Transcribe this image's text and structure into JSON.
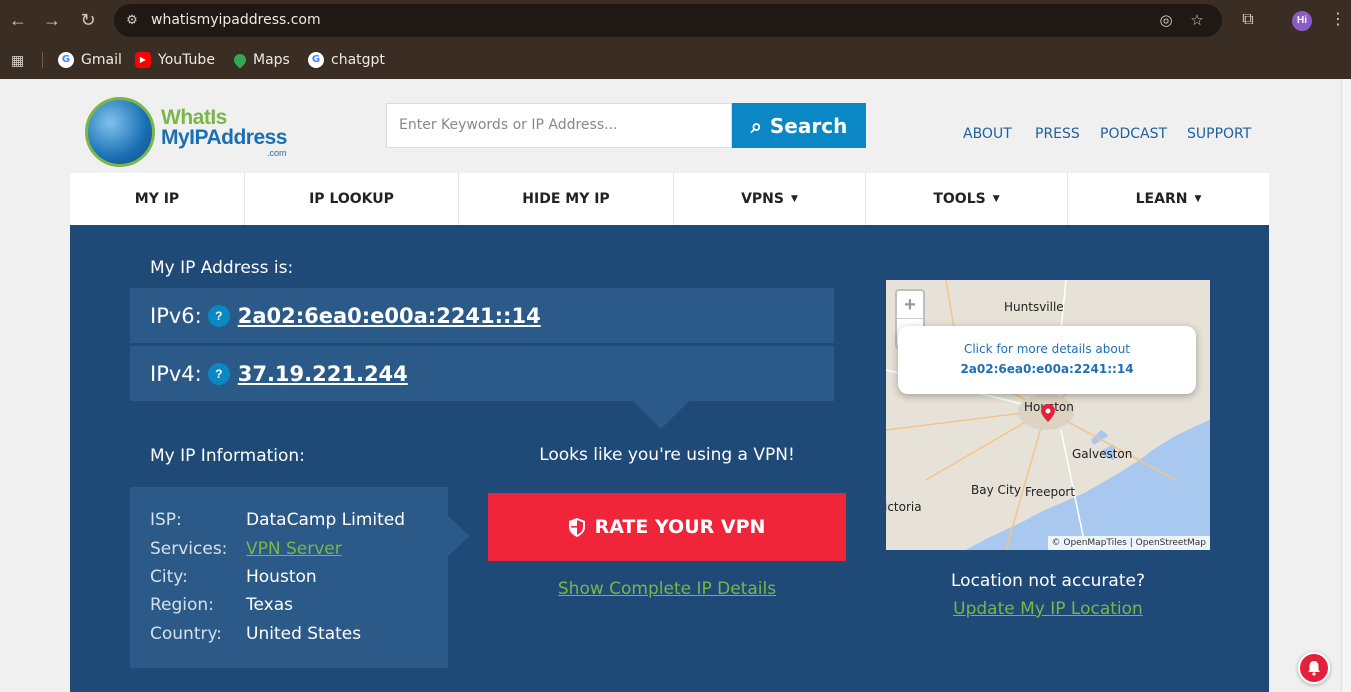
{
  "browser": {
    "url": "whatismyipaddress.com",
    "avatar": "Hi",
    "bookmarks": [
      {
        "label": "Gmail",
        "icon": "google-icon"
      },
      {
        "label": "YouTube",
        "icon": "youtube-icon"
      },
      {
        "label": "Maps",
        "icon": "maps-icon"
      },
      {
        "label": "chatgpt",
        "icon": "google-icon"
      }
    ]
  },
  "logo": {
    "line1": "WhatIs",
    "line2": "MyIPAddress",
    "line3": ".com"
  },
  "search": {
    "placeholder": "Enter Keywords or IP Address...",
    "button": "Search"
  },
  "top_links": [
    "ABOUT",
    "PRESS",
    "PODCAST",
    "SUPPORT"
  ],
  "main_nav": [
    {
      "label": "MY IP",
      "caret": ""
    },
    {
      "label": "IP LOOKUP",
      "caret": ""
    },
    {
      "label": "HIDE MY IP",
      "caret": ""
    },
    {
      "label": "VPNS",
      "caret": "▼"
    },
    {
      "label": "TOOLS",
      "caret": "▼"
    },
    {
      "label": "LEARN",
      "caret": "▼"
    }
  ],
  "ip": {
    "title": "My IP Address is:",
    "ipv6_label": "IPv6:",
    "ipv6": "2a02:6ea0:e00a:2241::14",
    "ipv4_label": "IPv4:",
    "ipv4": "37.19.221.244",
    "help": "?"
  },
  "info": {
    "title": "My IP Information:",
    "rows": [
      {
        "key": "ISP:",
        "value": "DataCamp Limited"
      },
      {
        "key": "Services:",
        "value": "VPN Server"
      },
      {
        "key": "City:",
        "value": "Houston"
      },
      {
        "key": "Region:",
        "value": "Texas"
      },
      {
        "key": "Country:",
        "value": "United States"
      }
    ]
  },
  "vpn": {
    "message": "Looks like you're using a VPN!",
    "rate_button": "RATE YOUR VPN",
    "complete_link": "Show Complete IP Details"
  },
  "map": {
    "zoom_in": "+",
    "zoom_out": "−",
    "popup_line1": "Click for more details about",
    "popup_line2": "2a02:6ea0:e00a:2241::14",
    "labels": [
      "Huntsville",
      "Houston",
      "Galveston",
      "Bay City",
      "Freeport",
      "ictoria"
    ],
    "attribution": "© OpenMapTiles | OpenStreetMap",
    "colors": {
      "land": "#e6e2d8",
      "water": "#a9c8f0",
      "pin": "#e4213c"
    }
  },
  "location": {
    "question": "Location not accurate?",
    "link": "Update My IP Location"
  }
}
